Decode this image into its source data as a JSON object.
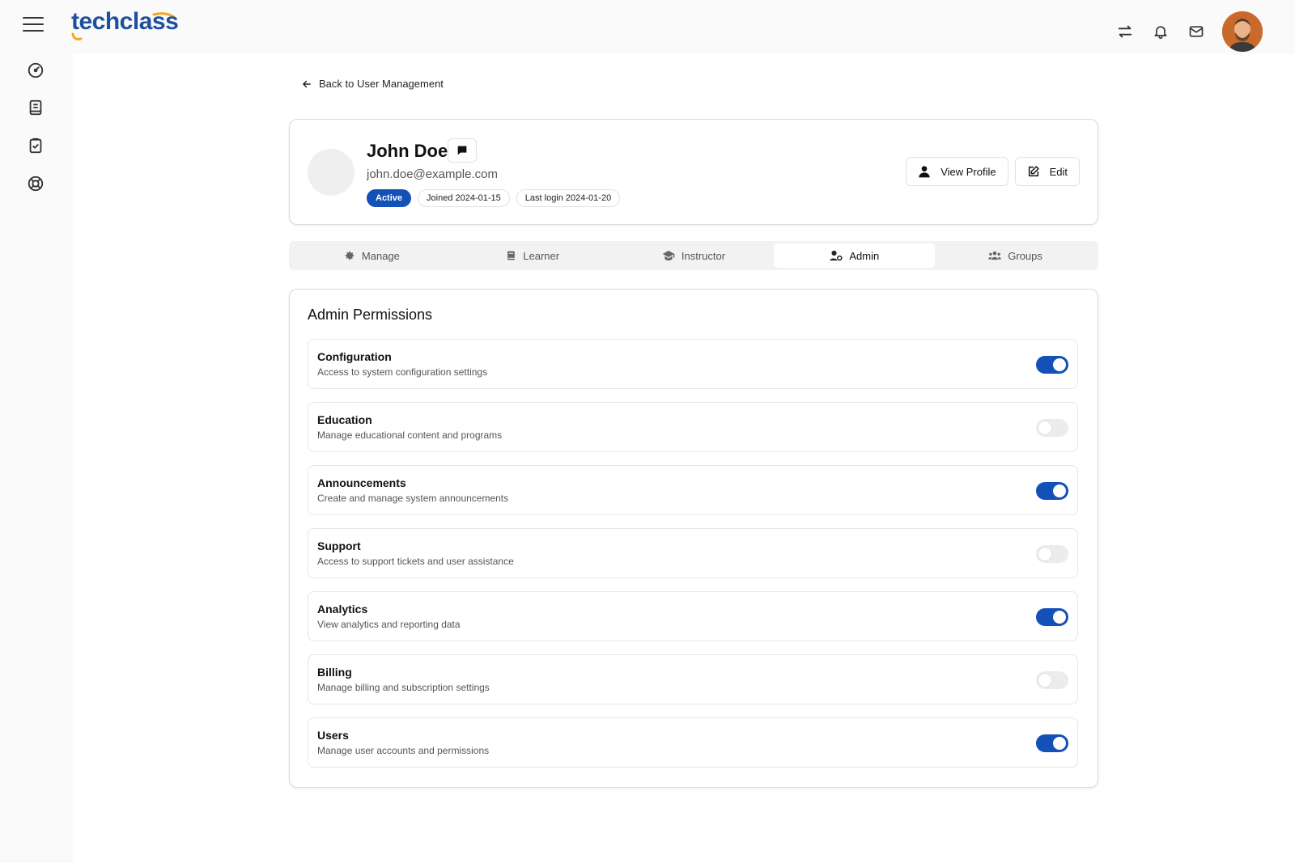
{
  "app": {
    "logo": "techclass"
  },
  "nav": {
    "back_label": "Back to User Management"
  },
  "user": {
    "name": "John Doe",
    "email": "john.doe@example.com",
    "status": "Active",
    "joined": "Joined 2024-01-15",
    "last_login": "Last login 2024-01-20",
    "view_profile_label": "View Profile",
    "edit_label": "Edit"
  },
  "tabs": [
    {
      "label": "Manage",
      "icon": "gear-icon"
    },
    {
      "label": "Learner",
      "icon": "book-icon"
    },
    {
      "label": "Instructor",
      "icon": "graduation-cap-icon"
    },
    {
      "label": "Admin",
      "icon": "user-gear-icon",
      "selected": true
    },
    {
      "label": "Groups",
      "icon": "users-icon"
    }
  ],
  "permissions": {
    "title": "Admin Permissions",
    "items": [
      {
        "label": "Configuration",
        "description": "Access to system configuration settings",
        "enabled": true
      },
      {
        "label": "Education",
        "description": "Manage educational content and programs",
        "enabled": false
      },
      {
        "label": "Announcements",
        "description": "Create and manage system announcements",
        "enabled": true
      },
      {
        "label": "Support",
        "description": "Access to support tickets and user assistance",
        "enabled": false
      },
      {
        "label": "Analytics",
        "description": "View analytics and reporting data",
        "enabled": true
      },
      {
        "label": "Billing",
        "description": "Manage billing and subscription settings",
        "enabled": false
      },
      {
        "label": "Users",
        "description": "Manage user accounts and permissions",
        "enabled": true
      }
    ]
  },
  "colors": {
    "accent": "#1350b8",
    "logo": "#1e4fa0",
    "logo_arc": "#f5a623"
  }
}
